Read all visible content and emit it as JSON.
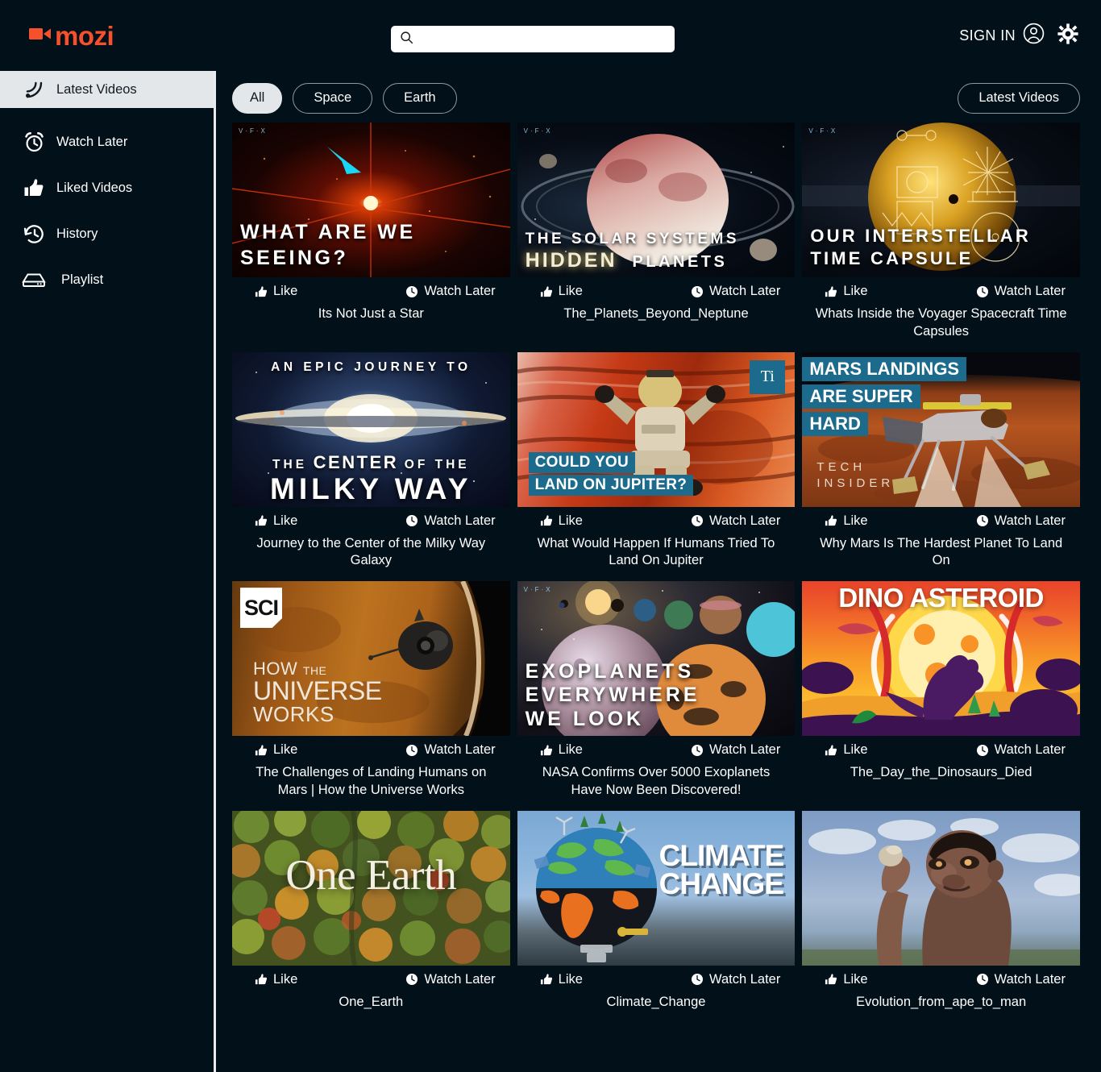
{
  "brand": {
    "name": "mozi",
    "color": "#f6502c",
    "icon": "video-camera-icon"
  },
  "search": {
    "value": "",
    "placeholder": "",
    "icon": "search-icon"
  },
  "header": {
    "sign_in_label": "SIGN IN",
    "account_icon": "user-circle-icon",
    "settings_icon": "gear-icon"
  },
  "sidebar": {
    "items": [
      {
        "label": "Latest Videos",
        "icon": "rss-icon",
        "active": true
      },
      {
        "label": "Watch Later",
        "icon": "alarm-clock-icon",
        "active": false
      },
      {
        "label": "Liked Videos",
        "icon": "thumbs-up-icon",
        "active": false
      },
      {
        "label": "History",
        "icon": "history-clock-icon",
        "active": false
      },
      {
        "label": "Playlist",
        "icon": "playlist-box-icon",
        "active": false
      }
    ]
  },
  "toolbar": {
    "filters": [
      {
        "label": "All",
        "active": true
      },
      {
        "label": "Space",
        "active": false
      },
      {
        "label": "Earth",
        "active": false
      }
    ],
    "sort_label": "Latest Videos"
  },
  "actions": {
    "like_label": "Like",
    "like_icon": "thumbs-up-icon",
    "watch_later_label": "Watch Later",
    "watch_later_icon": "clock-icon"
  },
  "videos": [
    {
      "title": "Its Not Just a Star",
      "thumb_text": "WHAT ARE WE SEEING?",
      "thumb_style": "star-burst"
    },
    {
      "title": "The_Planets_Beyond_Neptune",
      "thumb_text": "THE SOLAR SYSTEMS HIDDEN PLANETS",
      "thumb_style": "ringed-planet"
    },
    {
      "title": "Whats Inside the Voyager Spacecraft Time Capsules",
      "thumb_text": "OUR INTERSTELLAR TIME CAPSULE",
      "thumb_style": "golden-record"
    },
    {
      "title": "Journey to the Center of the Milky Way Galaxy",
      "thumb_text": "AN EPIC JOURNEY TO THE CENTER OF THE MILKY WAY",
      "thumb_style": "galaxy"
    },
    {
      "title": "What Would Happen If Humans Tried To Land On Jupiter",
      "thumb_text": "COULD YOU LAND ON JUPITER?",
      "thumb_style": "jupiter-astronaut",
      "badge": "Ti"
    },
    {
      "title": "Why Mars Is The Hardest Planet To Land On",
      "thumb_text": "MARS LANDINGS ARE SUPER HARD",
      "thumb_style": "mars-lander",
      "watermark": "TECH INSIDER"
    },
    {
      "title": "The Challenges of Landing Humans on Mars | How the Universe Works",
      "thumb_text": "HOW THE UNIVERSE WORKS",
      "thumb_style": "mars-orbit",
      "badge": "SCI"
    },
    {
      "title": "NASA Confirms Over 5000 Exoplanets Have Now Been Discovered!",
      "thumb_text": "EXOPLANETS EVERYWHERE WE LOOK",
      "thumb_style": "exoplanets"
    },
    {
      "title": "The_Day_the_Dinosaurs_Died",
      "thumb_text": "DINO ASTEROID",
      "thumb_style": "dino"
    },
    {
      "title": "One_Earth",
      "thumb_text": "One Earth",
      "thumb_style": "forest"
    },
    {
      "title": "Climate_Change",
      "thumb_text": "CLIMATE CHANGE",
      "thumb_style": "climate"
    },
    {
      "title": "Evolution_from_ape_to_man",
      "thumb_text": "",
      "thumb_style": "ape"
    }
  ]
}
